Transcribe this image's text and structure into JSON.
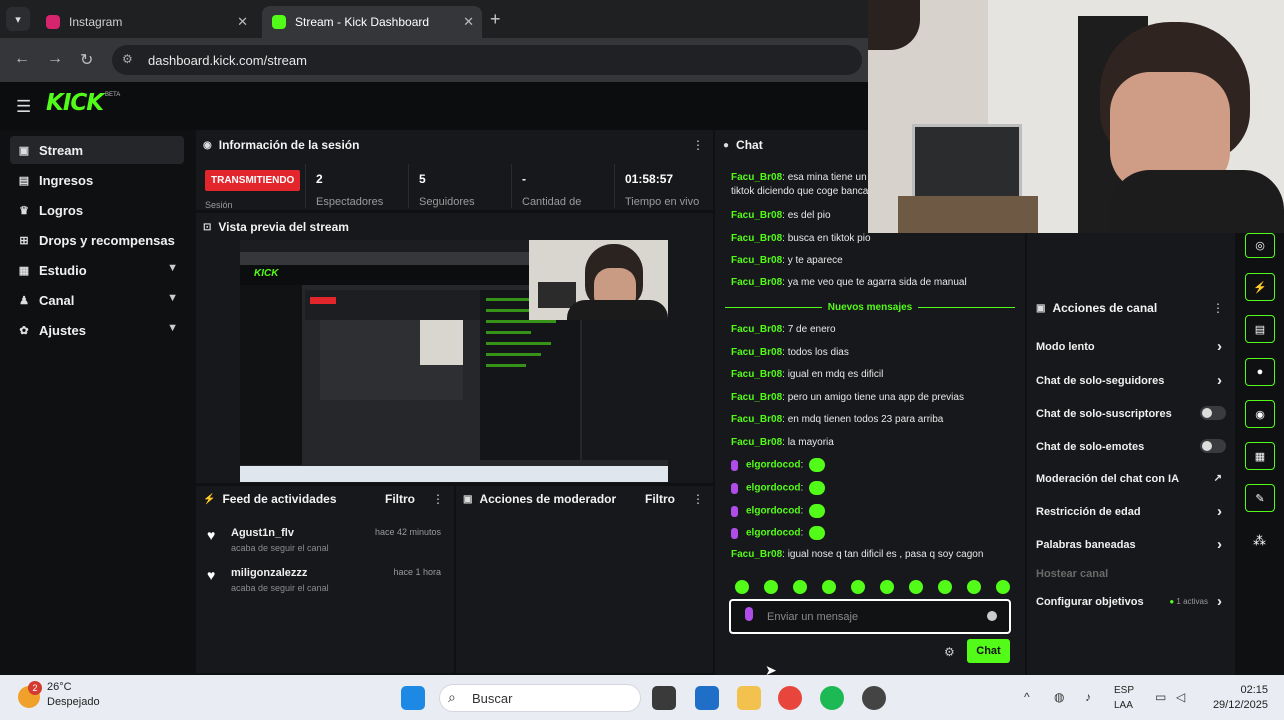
{
  "browser": {
    "tabs": [
      {
        "label": "Instagram",
        "active": false
      },
      {
        "label": "Stream - Kick Dashboard",
        "active": true
      }
    ],
    "address": "dashboard.kick.com/stream"
  },
  "header": {
    "logo": "KICK",
    "logo_badge": "BETA"
  },
  "sidebar": {
    "items": [
      {
        "label": "Stream",
        "icon": "stream-icon",
        "active": true
      },
      {
        "label": "Ingresos",
        "icon": "wallet-icon"
      },
      {
        "label": "Logros",
        "icon": "trophy-icon"
      },
      {
        "label": "Drops y recompensas",
        "icon": "gift-icon"
      },
      {
        "label": "Estudio",
        "icon": "monitor-icon",
        "expandable": true
      },
      {
        "label": "Canal",
        "icon": "users-icon",
        "expandable": true
      },
      {
        "label": "Ajustes",
        "icon": "gear-icon",
        "expandable": true
      }
    ]
  },
  "session": {
    "title": "Información de la sesión",
    "live_badge": "TRANSMITIENDO",
    "live_sub": "Sesión",
    "stats": [
      {
        "value": "2",
        "label": "Espectadores"
      },
      {
        "value": "5",
        "label": "Seguidores"
      },
      {
        "value": "-",
        "label": "Cantidad de"
      },
      {
        "value": "01:58:57",
        "label": "Tiempo en vivo"
      }
    ]
  },
  "preview": {
    "title": "Vista previa del stream"
  },
  "feed": {
    "title": "Feed de actividades",
    "filter": "Filtro",
    "items": [
      {
        "name": "Agust1n_flv",
        "time": "hace 42 minutos",
        "sub": "acaba de seguir el canal"
      },
      {
        "name": "miligonzalezzz",
        "time": "hace 1 hora",
        "sub": "acaba de seguir el canal"
      }
    ]
  },
  "moderator": {
    "title": "Acciones de moderador",
    "filter": "Filtro"
  },
  "chat": {
    "title": "Chat",
    "new_messages": "Nuevos mensajes",
    "messages_before": [
      {
        "user": "Facu_Br08",
        "text": "esa mina tiene un"
      },
      {
        "user": "",
        "text": "tiktok diciendo que coge banca"
      },
      {
        "user": "Facu_Br08",
        "text": "es del pio"
      },
      {
        "user": "Facu_Br08",
        "text": "busca en tiktok pio"
      },
      {
        "user": "Facu_Br08",
        "text": "y te aparece"
      },
      {
        "user": "Facu_Br08",
        "text": "ya me veo que te agarra sida de manual"
      }
    ],
    "messages_after": [
      {
        "user": "Facu_Br08",
        "text": "7 de enero"
      },
      {
        "user": "Facu_Br08",
        "text": "todos los dias"
      },
      {
        "user": "Facu_Br08",
        "text": "igual en mdq es dificil"
      },
      {
        "user": "Facu_Br08",
        "text": "pero un amigo tiene una app de previas"
      },
      {
        "user": "Facu_Br08",
        "text": "en mdq tienen todos 23 para arriba"
      },
      {
        "user": "Facu_Br08",
        "text": "la mayoria"
      },
      {
        "user": "elgordocod",
        "text": "",
        "emote": true
      },
      {
        "user": "elgordocod",
        "text": "",
        "emote": true
      },
      {
        "user": "elgordocod",
        "text": "",
        "emote": true
      },
      {
        "user": "elgordocod",
        "text": "",
        "emote": true
      },
      {
        "user": "Facu_Br08",
        "text": "igual nose q tan dificil es , pasa q soy cagon"
      }
    ],
    "input_placeholder": "Enviar un mensaje",
    "send_label": "Chat"
  },
  "channel_actions": {
    "title": "Acciones de canal",
    "items": [
      {
        "label": "Modo lento",
        "control": "chevron"
      },
      {
        "label": "Chat de solo-seguidores",
        "control": "chevron"
      },
      {
        "label": "Chat de solo-suscriptores",
        "control": "toggle"
      },
      {
        "label": "Chat de solo-emotes",
        "control": "toggle"
      },
      {
        "label": "Moderación del chat con IA",
        "control": "external"
      },
      {
        "label": "Restricción de edad",
        "control": "chevron"
      },
      {
        "label": "Palabras baneadas",
        "control": "chevron"
      },
      {
        "label": "Hostear canal",
        "control": "none",
        "disabled": true
      },
      {
        "label": "Configurar objetivos",
        "control": "chevron",
        "badge": "1 activas"
      }
    ]
  },
  "taskbar": {
    "weather_temp": "26°C",
    "weather_desc": "Despejado",
    "weather_badge": "2",
    "search_placeholder": "Buscar",
    "lang1": "ESP",
    "lang2": "LAA",
    "time": "02:15",
    "date": "29/12/2025"
  },
  "colors": {
    "accent": "#53fc18",
    "live": "#e3262c",
    "panel": "#17181b"
  }
}
